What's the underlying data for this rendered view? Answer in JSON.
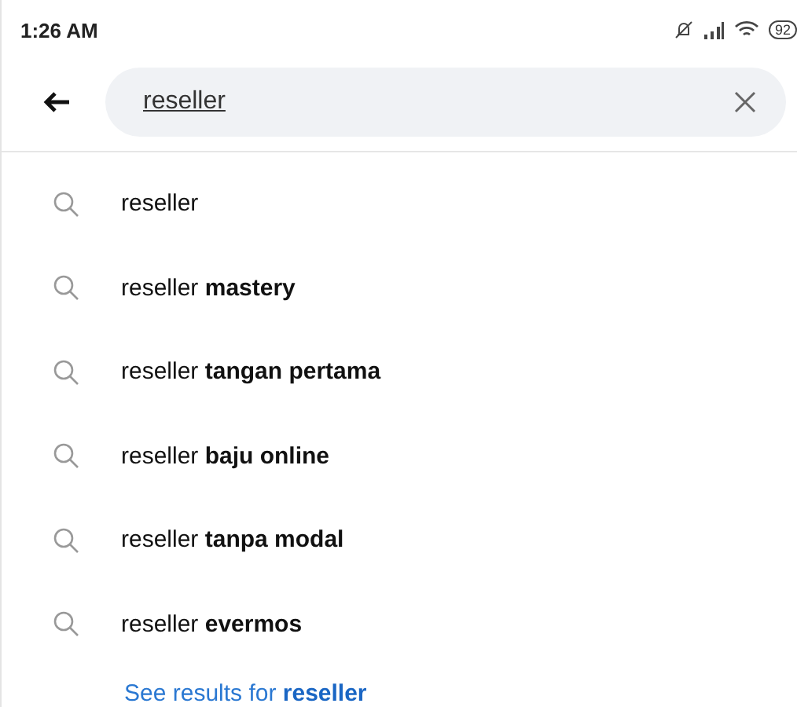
{
  "status_bar": {
    "time": "1:26 AM",
    "battery": "92"
  },
  "search": {
    "value": "reseller"
  },
  "suggestions": [
    {
      "text": "reseller"
    },
    {
      "text": "reseller **mastery**"
    },
    {
      "text": "reseller **tangan pertama**"
    },
    {
      "text": "reseller **baju online**"
    },
    {
      "text": "reseller **tanpa modal**"
    },
    {
      "text": "reseller **evermos**"
    }
  ],
  "see_results": "See results for **reseller**"
}
